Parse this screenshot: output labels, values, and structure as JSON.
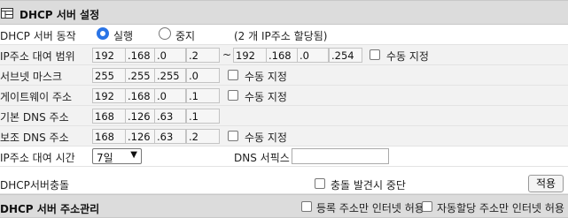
{
  "dhcp_server": {
    "title": "DHCP 서버 설정",
    "operation": {
      "label": "DHCP 서버 동작",
      "options": [
        "실행",
        "중지"
      ],
      "selected": "실행",
      "note": "(2 개 IP주소 할당됨)"
    },
    "ip_range": {
      "label": "IP주소 대여 범위",
      "start": [
        "192",
        ".168",
        ".0",
        ".2"
      ],
      "separator": "~",
      "end": [
        "192",
        ".168",
        ".0",
        ".254"
      ],
      "manual_label": "수동 지정"
    },
    "subnet_mask": {
      "label": "서브넷 마스크",
      "octets": [
        "255",
        ".255",
        ".255",
        ".0"
      ],
      "manual_label": "수동 지정"
    },
    "gateway": {
      "label": "게이트웨이 주소",
      "octets": [
        "192",
        ".168",
        ".0",
        ".1"
      ],
      "manual_label": "수동 지정"
    },
    "primary_dns": {
      "label": "기본 DNS 주소",
      "octets": [
        "168",
        ".126",
        ".63",
        ".1"
      ]
    },
    "secondary_dns": {
      "label": "보조 DNS 주소",
      "octets": [
        "168",
        ".126",
        ".63",
        ".2"
      ],
      "manual_label": "수동 지정"
    },
    "lease_time": {
      "label": "IP주소 대여 시간",
      "selected": "7일",
      "dns_suffix_label": "DNS 서픽스",
      "dns_suffix_value": ""
    },
    "conflict": {
      "label": "DHCP서버충돌",
      "stop_on_conflict_label": "충돌 발견시 중단",
      "apply_label": "적용"
    }
  },
  "address_management": {
    "title": "DHCP 서버 주소관리",
    "registered_only_label": "등록 주소만 인터넷 허용",
    "auto_assigned_only_label": "자동할당 주소만 인터넷 허용"
  }
}
